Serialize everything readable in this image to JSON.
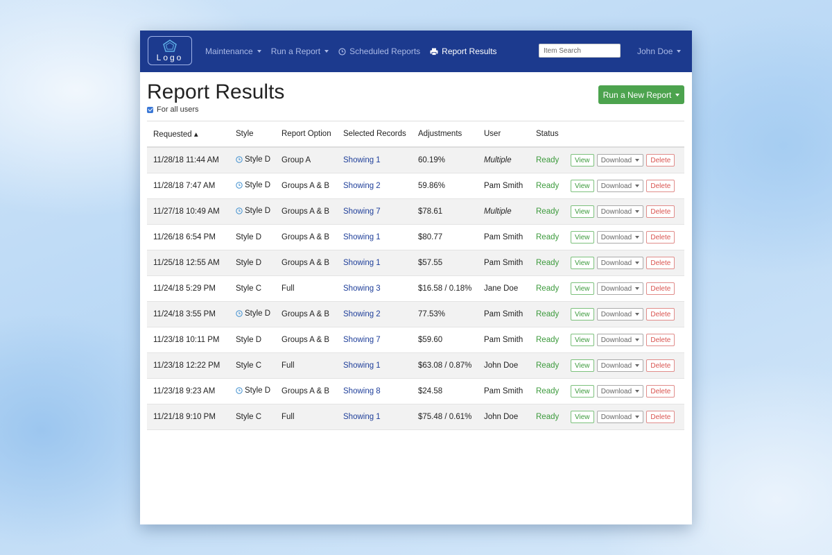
{
  "nav": {
    "logo_text": "Logo",
    "items": [
      {
        "label": "Maintenance",
        "dropdown": true
      },
      {
        "label": "Run a Report",
        "dropdown": true
      },
      {
        "label": "Scheduled Reports",
        "icon": "clock-icon"
      },
      {
        "label": "Report Results",
        "icon": "printer-icon",
        "active": true
      }
    ],
    "search_placeholder": "Item Search",
    "user_name": "John Doe"
  },
  "page": {
    "title": "Report Results",
    "for_all_users_label": "For all users",
    "for_all_users_checked": true,
    "run_report_label": "Run a New Report"
  },
  "table": {
    "headers": [
      "Requested ▴",
      "Style",
      "Report Option",
      "Selected Records",
      "Adjustments",
      "User",
      "Status"
    ],
    "action_labels": {
      "view": "View",
      "download": "Download",
      "delete": "Delete"
    },
    "rows": [
      {
        "requested": "11/28/18 11:44 AM",
        "scheduled": true,
        "style": "Style D",
        "option": "Group A",
        "records": "Showing 1",
        "adjustments": "60.19%",
        "user": "Multiple",
        "user_italic": true,
        "status": "Ready"
      },
      {
        "requested": "11/28/18 7:47 AM",
        "scheduled": true,
        "style": "Style D",
        "option": "Groups A & B",
        "records": "Showing 2",
        "adjustments": "59.86%",
        "user": "Pam Smith",
        "user_italic": false,
        "status": "Ready"
      },
      {
        "requested": "11/27/18 10:49 AM",
        "scheduled": true,
        "style": "Style D",
        "option": "Groups A & B",
        "records": "Showing 7",
        "adjustments": "$78.61",
        "user": "Multiple",
        "user_italic": true,
        "status": "Ready"
      },
      {
        "requested": "11/26/18 6:54 PM",
        "scheduled": false,
        "style": "Style D",
        "option": "Groups A & B",
        "records": "Showing 1",
        "adjustments": "$80.77",
        "user": "Pam Smith",
        "user_italic": false,
        "status": "Ready"
      },
      {
        "requested": "11/25/18 12:55 AM",
        "scheduled": false,
        "style": "Style D",
        "option": "Groups A & B",
        "records": "Showing 1",
        "adjustments": "$57.55",
        "user": "Pam Smith",
        "user_italic": false,
        "status": "Ready"
      },
      {
        "requested": "11/24/18 5:29 PM",
        "scheduled": false,
        "style": "Style C",
        "option": "Full",
        "records": "Showing 3",
        "adjustments": "$16.58 / 0.18%",
        "user": "Jane Doe",
        "user_italic": false,
        "status": "Ready"
      },
      {
        "requested": "11/24/18 3:55 PM",
        "scheduled": true,
        "style": "Style D",
        "option": "Groups A & B",
        "records": "Showing 2",
        "adjustments": "77.53%",
        "user": "Pam Smith",
        "user_italic": false,
        "status": "Ready"
      },
      {
        "requested": "11/23/18 10:11 PM",
        "scheduled": false,
        "style": "Style D",
        "option": "Groups A & B",
        "records": "Showing 7",
        "adjustments": "$59.60",
        "user": "Pam Smith",
        "user_italic": false,
        "status": "Ready"
      },
      {
        "requested": "11/23/18 12:22 PM",
        "scheduled": false,
        "style": "Style C",
        "option": "Full",
        "records": "Showing 1",
        "adjustments": "$63.08 / 0.87%",
        "user": "John Doe",
        "user_italic": false,
        "status": "Ready"
      },
      {
        "requested": "11/23/18 9:23 AM",
        "scheduled": true,
        "style": "Style D",
        "option": "Groups A & B",
        "records": "Showing 8",
        "adjustments": "$24.58",
        "user": "Pam Smith",
        "user_italic": false,
        "status": "Ready"
      },
      {
        "requested": "11/21/18 9:10 PM",
        "scheduled": false,
        "style": "Style C",
        "option": "Full",
        "records": "Showing 1",
        "adjustments": "$75.48 / 0.61%",
        "user": "John Doe",
        "user_italic": false,
        "status": "Ready"
      }
    ]
  },
  "colors": {
    "navbar": "#1c3a8e",
    "primary_button": "#4ca34e",
    "ready_status": "#3c9a3c",
    "link": "#1f3f9a",
    "delete": "#d9534f"
  }
}
